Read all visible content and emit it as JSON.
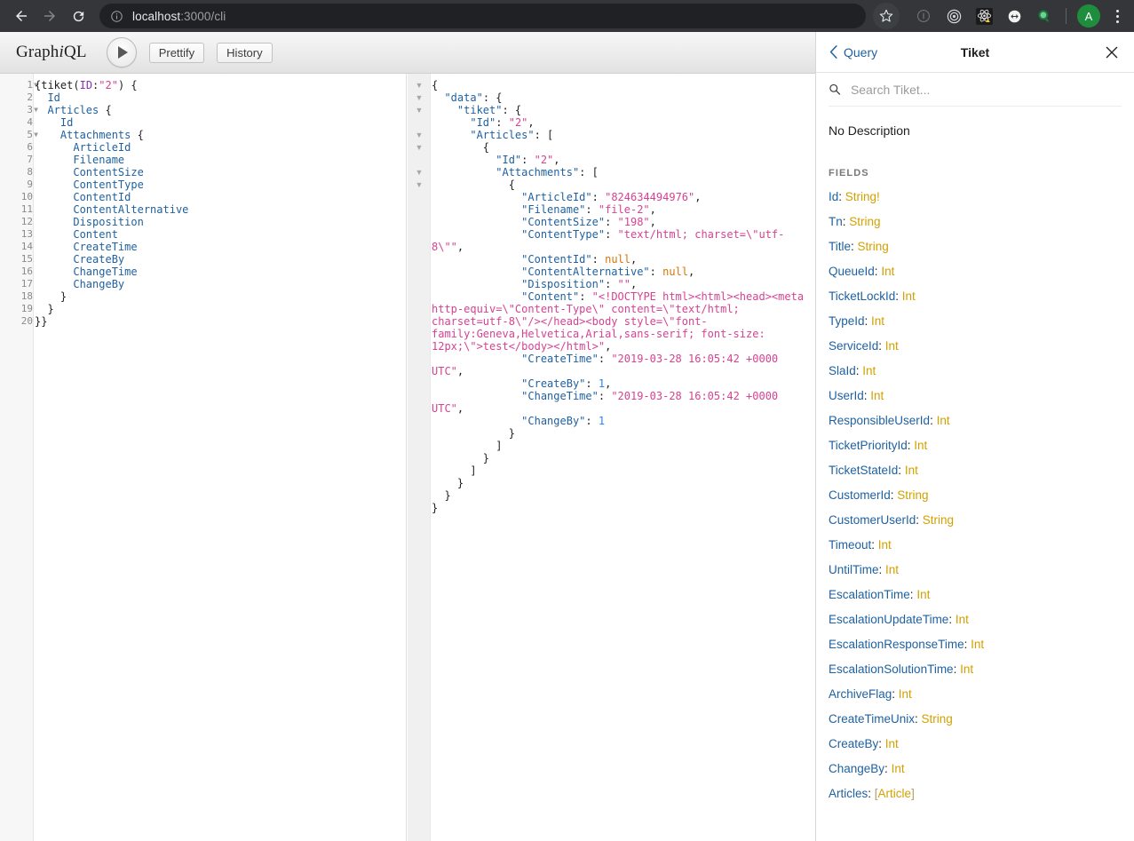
{
  "browser": {
    "back_icon": "arrow-left-icon",
    "forward_icon": "arrow-right-icon",
    "reload_icon": "reload-icon",
    "site_info_icon": "info-circle-icon",
    "url_host": "localhost",
    "url_path": ":3000/cli",
    "star_icon": "bookmark-star-icon",
    "extensions": [
      {
        "name": "info-extension-icon"
      },
      {
        "name": "target-extension-icon"
      },
      {
        "name": "react-devtools-extension-icon"
      },
      {
        "name": "resize-extension-icon"
      },
      {
        "name": "green-search-extension-icon"
      }
    ],
    "profile_initial": "A",
    "menu_icon": "kebab-menu-icon"
  },
  "graphiql": {
    "logo_pre": "Graph",
    "logo_i": "i",
    "logo_post": "QL",
    "execute_icon": "play-icon",
    "prettify_label": "Prettify",
    "history_label": "History"
  },
  "query_editor": {
    "lines": [
      {
        "n": 1,
        "fold": true,
        "html": "<span class=\"t-punct\">{</span><span class=\"t-def\">tiket</span><span class=\"t-punct\">(</span><span class=\"t-arg\">ID</span><span class=\"t-punct\">:</span><span class=\"t-str\">\"2\"</span><span class=\"t-punct\">) {</span>"
      },
      {
        "n": 2,
        "fold": false,
        "html": "  <span class=\"t-attr\">Id</span>"
      },
      {
        "n": 3,
        "fold": true,
        "html": "  <span class=\"t-attr\">Articles</span> <span class=\"t-punct\">{</span>"
      },
      {
        "n": 4,
        "fold": false,
        "html": "    <span class=\"t-attr\">Id</span>"
      },
      {
        "n": 5,
        "fold": true,
        "html": "    <span class=\"t-attr\">Attachments</span> <span class=\"t-punct\">{</span>"
      },
      {
        "n": 6,
        "fold": false,
        "html": "      <span class=\"t-attr\">ArticleId</span>"
      },
      {
        "n": 7,
        "fold": false,
        "html": "      <span class=\"t-attr\">Filename</span>"
      },
      {
        "n": 8,
        "fold": false,
        "html": "      <span class=\"t-attr\">ContentSize</span>"
      },
      {
        "n": 9,
        "fold": false,
        "html": "      <span class=\"t-attr\">ContentType</span>"
      },
      {
        "n": 10,
        "fold": false,
        "html": "      <span class=\"t-attr\">ContentId</span>"
      },
      {
        "n": 11,
        "fold": false,
        "html": "      <span class=\"t-attr\">ContentAlternative</span>"
      },
      {
        "n": 12,
        "fold": false,
        "html": "      <span class=\"t-attr\">Disposition</span>"
      },
      {
        "n": 13,
        "fold": false,
        "html": "      <span class=\"t-attr\">Content</span>"
      },
      {
        "n": 14,
        "fold": false,
        "html": "      <span class=\"t-attr\">CreateTime</span>"
      },
      {
        "n": 15,
        "fold": false,
        "html": "      <span class=\"t-attr\">CreateBy</span>"
      },
      {
        "n": 16,
        "fold": false,
        "html": "      <span class=\"t-attr\">ChangeTime</span>"
      },
      {
        "n": 17,
        "fold": false,
        "html": "      <span class=\"t-attr\">ChangeBy</span>"
      },
      {
        "n": 18,
        "fold": false,
        "html": "    <span class=\"t-punct\">}</span>"
      },
      {
        "n": 19,
        "fold": false,
        "html": "  <span class=\"t-punct\">}</span>"
      },
      {
        "n": 20,
        "fold": false,
        "html": "<span class=\"t-punct\">}}</span>"
      }
    ],
    "plain_text": "{tiket(ID:\"2\") {\n  Id\n  Articles {\n    Id\n    Attachments {\n      ArticleId\n      Filename\n      ContentSize\n      ContentType\n      ContentId\n      ContentAlternative\n      Disposition\n      Content\n      CreateTime\n      CreateBy\n      ChangeTime\n      ChangeBy\n    }\n  }\n}}"
  },
  "result_viewer": {
    "fold_rows": [
      0,
      1,
      2,
      4,
      5,
      7,
      8
    ],
    "html": "<span class=\"t-punct\">{</span>\n  <span class=\"t-key\">\"data\"</span><span class=\"t-punct\">: {</span>\n    <span class=\"t-key\">\"tiket\"</span><span class=\"t-punct\">: {</span>\n      <span class=\"t-key\">\"Id\"</span><span class=\"t-punct\">: </span><span class=\"t-jstr\">\"2\"</span><span class=\"t-punct\">,</span>\n      <span class=\"t-key\">\"Articles\"</span><span class=\"t-punct\">: [</span>\n        <span class=\"t-punct\">{</span>\n          <span class=\"t-key\">\"Id\"</span><span class=\"t-punct\">: </span><span class=\"t-jstr\">\"2\"</span><span class=\"t-punct\">,</span>\n          <span class=\"t-key\">\"Attachments\"</span><span class=\"t-punct\">: [</span>\n            <span class=\"t-punct\">{</span>\n              <span class=\"t-key\">\"ArticleId\"</span><span class=\"t-punct\">: </span><span class=\"t-jstr\">\"824634494976\"</span><span class=\"t-punct\">,</span>\n              <span class=\"t-key\">\"Filename\"</span><span class=\"t-punct\">: </span><span class=\"t-jstr\">\"file-2\"</span><span class=\"t-punct\">,</span>\n              <span class=\"t-key\">\"ContentSize\"</span><span class=\"t-punct\">: </span><span class=\"t-jstr\">\"198\"</span><span class=\"t-punct\">,</span>\n              <span class=\"t-key\">\"ContentType\"</span><span class=\"t-punct\">: </span><span class=\"t-jstr\">\"text/html; charset=\\\"utf-8\\\"\"</span><span class=\"t-punct\">,</span>\n              <span class=\"t-key\">\"ContentId\"</span><span class=\"t-punct\">: </span><span class=\"t-null\">null</span><span class=\"t-punct\">,</span>\n              <span class=\"t-key\">\"ContentAlternative\"</span><span class=\"t-punct\">: </span><span class=\"t-null\">null</span><span class=\"t-punct\">,</span>\n              <span class=\"t-key\">\"Disposition\"</span><span class=\"t-punct\">: </span><span class=\"t-jstr\">\"\"</span><span class=\"t-punct\">,</span>\n              <span class=\"t-key\">\"Content\"</span><span class=\"t-punct\">: </span><span class=\"t-jstr\">\"&lt;!DOCTYPE html&gt;&lt;html&gt;&lt;head&gt;&lt;meta http-equiv=\\\"Content-Type\\\" content=\\\"text/html; charset=utf-8\\\"/&gt;&lt;/head&gt;&lt;body style=\\\"font-family:Geneva,Helvetica,Arial,sans-serif; font-size: 12px;\\\"&gt;test&lt;/body&gt;&lt;/html&gt;\"</span><span class=\"t-punct\">,</span>\n              <span class=\"t-key\">\"CreateTime\"</span><span class=\"t-punct\">: </span><span class=\"t-jstr\">\"2019-03-28 16:05:42 +0000 UTC\"</span><span class=\"t-punct\">,</span>\n              <span class=\"t-key\">\"CreateBy\"</span><span class=\"t-punct\">: </span><span class=\"t-num\">1</span><span class=\"t-punct\">,</span>\n              <span class=\"t-key\">\"ChangeTime\"</span><span class=\"t-punct\">: </span><span class=\"t-jstr\">\"2019-03-28 16:05:42 +0000 UTC\"</span><span class=\"t-punct\">,</span>\n              <span class=\"t-key\">\"ChangeBy\"</span><span class=\"t-punct\">: </span><span class=\"t-num\">1</span>\n            <span class=\"t-punct\">}</span>\n          <span class=\"t-punct\">]</span>\n        <span class=\"t-punct\">}</span>\n      <span class=\"t-punct\">]</span>\n    <span class=\"t-punct\">}</span>\n  <span class=\"t-punct\">}</span>\n<span class=\"t-punct\">}</span>",
    "plain_text": "{\n  \"data\": {\n    \"tiket\": {\n      \"Id\": \"2\",\n      \"Articles\": [\n        {\n          \"Id\": \"2\",\n          \"Attachments\": [\n            {\n              \"ArticleId\": \"824634494976\",\n              \"Filename\": \"file-2\",\n              \"ContentSize\": \"198\",\n              \"ContentType\": \"text/html; charset=\\\"utf-8\\\"\",\n              \"ContentId\": null,\n              \"ContentAlternative\": null,\n              \"Disposition\": \"\",\n              \"Content\": \"<!DOCTYPE html><html><head><meta http-equiv=\\\"Content-Type\\\" content=\\\"text/html; charset=utf-8\\\"/></head><body style=\\\"font-family:Geneva,Helvetica,Arial,sans-serif; font-size: 12px;\\\">test</body></html>\",\n              \"CreateTime\": \"2019-03-28 16:05:42 +0000 UTC\",\n              \"CreateBy\": 1,\n              \"ChangeTime\": \"2019-03-28 16:05:42 +0000 UTC\",\n              \"ChangeBy\": 1\n            }\n          ]\n        }\n      ]\n    }\n  }\n}"
  },
  "docs": {
    "back_icon": "chevron-left-icon",
    "back_label": "Query",
    "title": "Tiket",
    "close_icon": "close-icon",
    "search_icon": "search-icon",
    "search_placeholder": "Search Tiket...",
    "search_value": "",
    "description": "No Description",
    "fields_heading": "FIELDS",
    "fields": [
      {
        "name": "Id",
        "type": "String",
        "nonnull": "!",
        "list": false
      },
      {
        "name": "Tn",
        "type": "String",
        "nonnull": "",
        "list": false
      },
      {
        "name": "Title",
        "type": "String",
        "nonnull": "",
        "list": false
      },
      {
        "name": "QueueId",
        "type": "Int",
        "nonnull": "",
        "list": false
      },
      {
        "name": "TicketLockId",
        "type": "Int",
        "nonnull": "",
        "list": false
      },
      {
        "name": "TypeId",
        "type": "Int",
        "nonnull": "",
        "list": false
      },
      {
        "name": "ServiceId",
        "type": "Int",
        "nonnull": "",
        "list": false
      },
      {
        "name": "SlaId",
        "type": "Int",
        "nonnull": "",
        "list": false
      },
      {
        "name": "UserId",
        "type": "Int",
        "nonnull": "",
        "list": false
      },
      {
        "name": "ResponsibleUserId",
        "type": "Int",
        "nonnull": "",
        "list": false
      },
      {
        "name": "TicketPriorityId",
        "type": "Int",
        "nonnull": "",
        "list": false
      },
      {
        "name": "TicketStateId",
        "type": "Int",
        "nonnull": "",
        "list": false
      },
      {
        "name": "CustomerId",
        "type": "String",
        "nonnull": "",
        "list": false
      },
      {
        "name": "CustomerUserId",
        "type": "String",
        "nonnull": "",
        "list": false
      },
      {
        "name": "Timeout",
        "type": "Int",
        "nonnull": "",
        "list": false
      },
      {
        "name": "UntilTime",
        "type": "Int",
        "nonnull": "",
        "list": false
      },
      {
        "name": "EscalationTime",
        "type": "Int",
        "nonnull": "",
        "list": false
      },
      {
        "name": "EscalationUpdateTime",
        "type": "Int",
        "nonnull": "",
        "list": false
      },
      {
        "name": "EscalationResponseTime",
        "type": "Int",
        "nonnull": "",
        "list": false
      },
      {
        "name": "EscalationSolutionTime",
        "type": "Int",
        "nonnull": "",
        "list": false
      },
      {
        "name": "ArchiveFlag",
        "type": "Int",
        "nonnull": "",
        "list": false
      },
      {
        "name": "CreateTimeUnix",
        "type": "String",
        "nonnull": "",
        "list": false
      },
      {
        "name": "CreateBy",
        "type": "Int",
        "nonnull": "",
        "list": false
      },
      {
        "name": "ChangeBy",
        "type": "Int",
        "nonnull": "",
        "list": false
      },
      {
        "name": "Articles",
        "type": "Article",
        "nonnull": "",
        "list": true
      }
    ]
  },
  "colors": {
    "chrome_bar": "#35363a",
    "omnibox": "#202124",
    "accent_blue": "#1f61a0",
    "type_orange": "#d2a000",
    "string_pink": "#d64292",
    "number_blue": "#2882f9",
    "null_orange": "#d47509",
    "avatar_green": "#1e8e3e"
  }
}
